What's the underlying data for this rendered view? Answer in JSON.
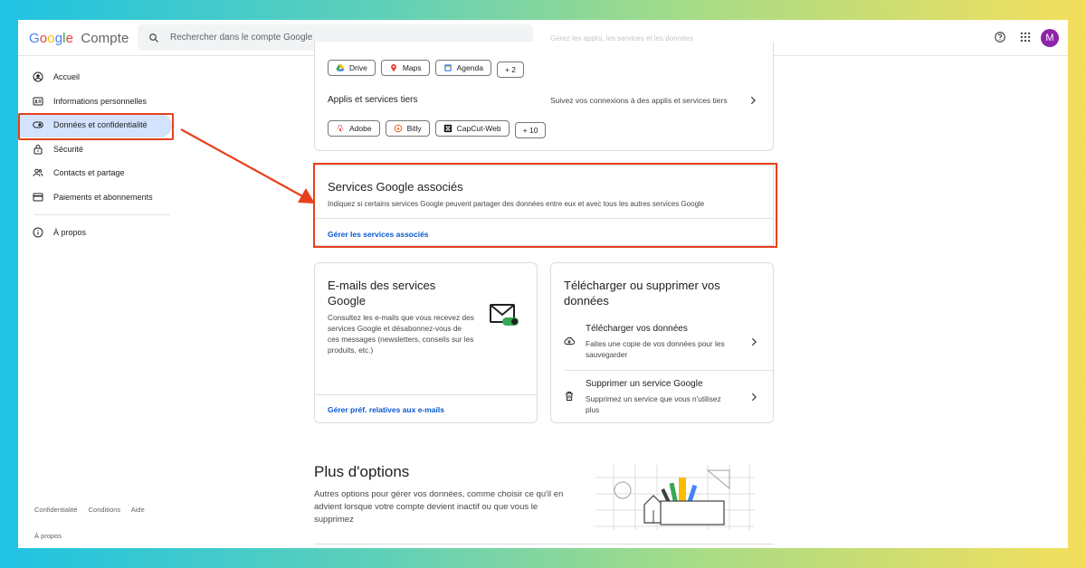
{
  "header": {
    "logo_letters": [
      "G",
      "o",
      "o",
      "g",
      "l",
      "e"
    ],
    "product": "Compte",
    "search_placeholder": "Rechercher dans le compte Google",
    "avatar_letter": "M",
    "hidden_text": "Gérez les applis, les services et les données"
  },
  "sidebar": {
    "items": [
      {
        "label": "Accueil",
        "icon": "account-circle-icon"
      },
      {
        "label": "Informations personnelles",
        "icon": "id-card-icon"
      },
      {
        "label": "Données et confidentialité",
        "icon": "toggle-icon",
        "active": true
      },
      {
        "label": "Sécurité",
        "icon": "lock-icon"
      },
      {
        "label": "Contacts et partage",
        "icon": "people-icon"
      },
      {
        "label": "Paiements et abonnements",
        "icon": "credit-card-icon"
      }
    ],
    "about": "À propos",
    "footer": [
      "Confidentialité",
      "Conditions",
      "Aide"
    ],
    "footer_about": "À propos"
  },
  "apps_card": {
    "google_chips": [
      "Drive",
      "Maps",
      "Agenda",
      "+ 2"
    ],
    "third_party_title": "Applis et services tiers",
    "third_party_desc": "Suivez vos connexions à des applis et services tiers",
    "third_party_chips": [
      "Adobe",
      "Bitly",
      "CapCut-Web",
      "+ 10"
    ]
  },
  "associated": {
    "title": "Services Google associés",
    "desc": "Indiquez si certains services Google peuvent partager des données entre eux et avec tous les autres services Google",
    "link": "Gérer les services associés"
  },
  "emails_card": {
    "title": "E-mails des services Google",
    "desc": "Consultez les e-mails que vous recevez des services Google et désabonnez-vous de ces messages (newsletters, conseils sur les produits, etc.)",
    "link": "Gérer préf. relatives aux e-mails"
  },
  "download_card": {
    "title": "Télécharger ou supprimer vos données",
    "download_title": "Télécharger vos données",
    "download_desc": "Faites une copie de vos données pour les sauvegarder",
    "delete_title": "Supprimer un service Google",
    "delete_desc": "Supprimez un service que vous n'utilisez plus"
  },
  "more_options": {
    "title": "Plus d'options",
    "desc": "Autres options pour gérer vos données, comme choisir ce qu'il en advient lorsque votre compte devient inactif ou que vous le supprimez"
  },
  "colors": {
    "annotation": "#e8401c",
    "active_nav": "#d3e3fd",
    "link": "#0b57d0"
  }
}
